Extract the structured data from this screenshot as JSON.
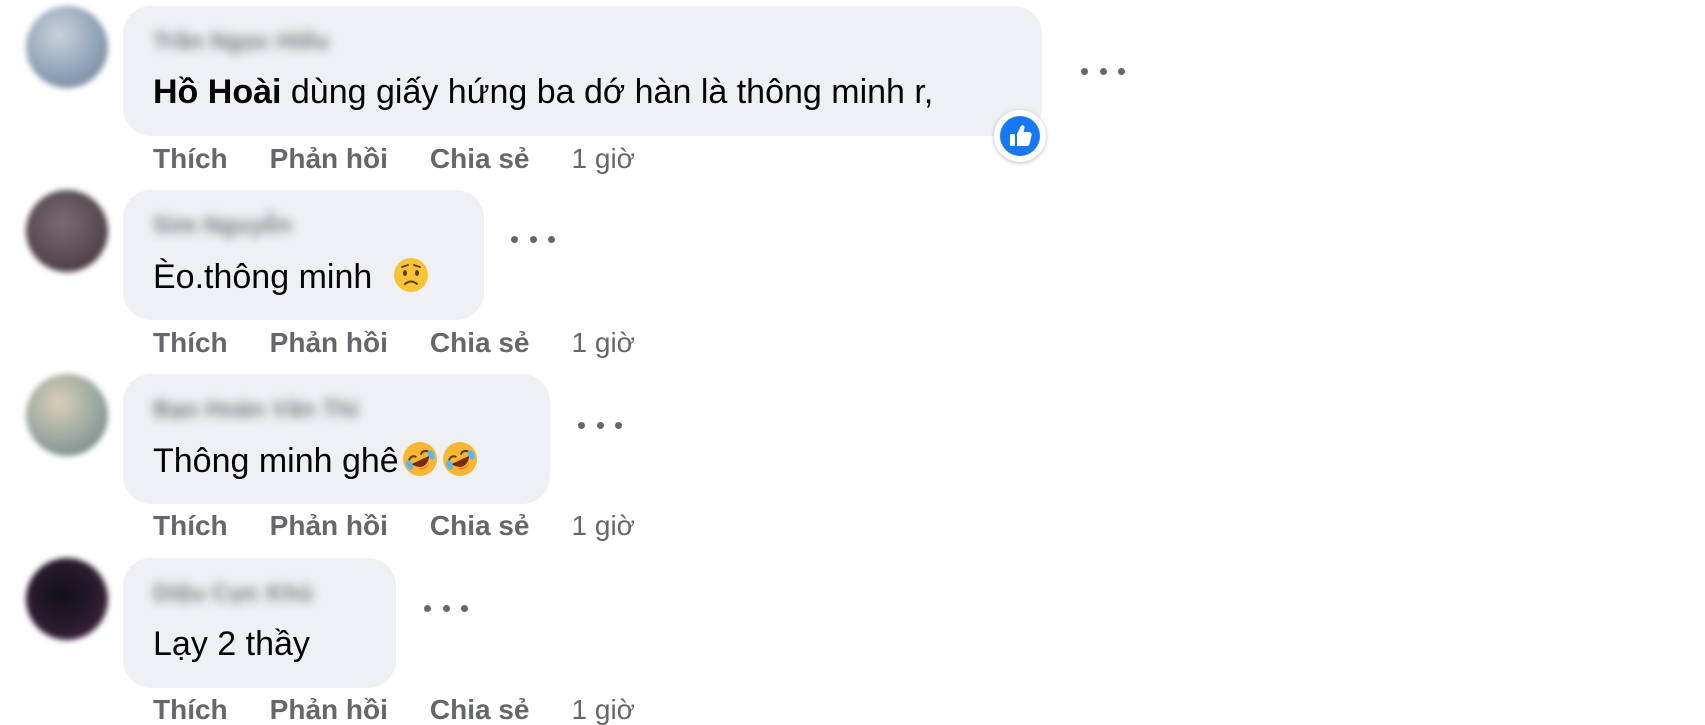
{
  "comments": [
    {
      "author": "Trần Ngọc Hiếu",
      "mention": "Hồ Hoài",
      "text": " dùng giấy hứng ba dớ hàn là thông minh r,",
      "reaction_icon": "like-icon",
      "avatar_color": "#8fa3b8",
      "actions": {
        "like": "Thích",
        "reply": "Phản hồi",
        "share": "Chia sẻ",
        "time": "1 giờ"
      }
    },
    {
      "author": "Sim Nguyễn",
      "mention": "",
      "text": "Èo.thông minh",
      "emoji": "worried-face-icon",
      "avatar_color": "#5a4a52",
      "actions": {
        "like": "Thích",
        "reply": "Phản hồi",
        "share": "Chia sẻ",
        "time": "1 giờ"
      }
    },
    {
      "author": "Bạo Hoàn Văn Thi",
      "mention": "",
      "text": "Thông minh ghê",
      "emoji": "rofl-face-icon",
      "avatar_color": "#9aa5a0",
      "actions": {
        "like": "Thích",
        "reply": "Phản hồi",
        "share": "Chia sẻ",
        "time": "1 giờ"
      }
    },
    {
      "author": "Diệu Cực Khủ",
      "mention": "",
      "text": "Lạy 2 thầy",
      "avatar_color": "#2a1c2e",
      "actions": {
        "like": "Thích",
        "reply": "Phản hồi",
        "share": "Chia sẻ",
        "time": "1 giờ"
      }
    }
  ],
  "colors": {
    "bubble": "#eff0f3",
    "secondary_text": "#65676b",
    "like_blue": "#1877f2"
  }
}
